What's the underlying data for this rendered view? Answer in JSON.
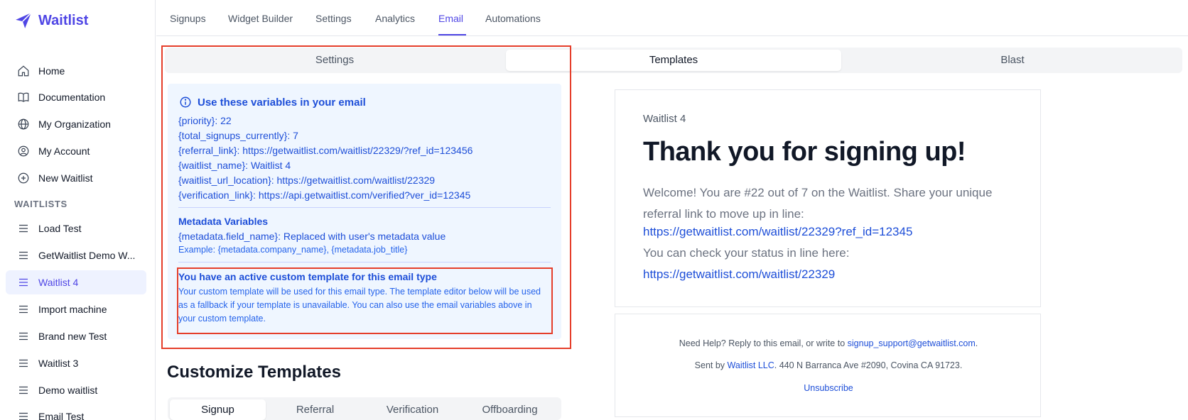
{
  "brand": {
    "name": "Waitlist"
  },
  "sidebar": {
    "items": [
      {
        "label": "Home"
      },
      {
        "label": "Documentation"
      },
      {
        "label": "My Organization"
      },
      {
        "label": "My Account"
      },
      {
        "label": "New Waitlist"
      }
    ],
    "section_label": "WAITLISTS",
    "waitlists": [
      {
        "label": "Load Test"
      },
      {
        "label": "GetWaitlist Demo W..."
      },
      {
        "label": "Waitlist 4"
      },
      {
        "label": "Import machine"
      },
      {
        "label": "Brand new Test"
      },
      {
        "label": "Waitlist 3"
      },
      {
        "label": "Demo waitlist"
      },
      {
        "label": "Email Test"
      }
    ],
    "active_waitlist": "Waitlist 4"
  },
  "topnav": {
    "tabs": [
      {
        "label": "Signups"
      },
      {
        "label": "Widget Builder"
      },
      {
        "label": "Settings"
      },
      {
        "label": "Analytics"
      },
      {
        "label": "Email"
      },
      {
        "label": "Automations"
      }
    ],
    "active": "Email"
  },
  "email_tabs": {
    "items": [
      {
        "label": "Settings"
      },
      {
        "label": "Templates"
      },
      {
        "label": "Blast"
      }
    ],
    "active": "Templates"
  },
  "variables": {
    "title": "Use these variables in your email",
    "lines": [
      "{priority}: 22",
      "{total_signups_currently}: 7",
      "{referral_link}: https://getwaitlist.com/waitlist/22329/?ref_id=123456",
      "{waitlist_name}: Waitlist 4",
      "{waitlist_url_location}: https://getwaitlist.com/waitlist/22329",
      "{verification_link}: https://api.getwaitlist.com/verified?ver_id=12345"
    ],
    "metadata_title": "Metadata Variables",
    "metadata_line": "{metadata.field_name}: Replaced with user's metadata value",
    "metadata_example": "Example: {metadata.company_name}, {metadata.job_title}",
    "custom_title": "You have an active custom template for this email type",
    "custom_desc": "Your custom template will be used for this email type. The template editor below will be used as a fallback if your template is unavailable. You can also use the email variables above in your custom template."
  },
  "customize": {
    "title": "Customize Templates",
    "tabs": [
      {
        "label": "Signup"
      },
      {
        "label": "Referral"
      },
      {
        "label": "Verification"
      },
      {
        "label": "Offboarding"
      }
    ],
    "active": "Signup"
  },
  "preview": {
    "waitlist_name": "Waitlist 4",
    "heading": "Thank you for signing up!",
    "body": "Welcome! You are #22 out of 7 on the Waitlist. Share your unique referral link to move up in line:",
    "referral_link": "https://getwaitlist.com/waitlist/22329?ref_id=12345",
    "status_text": "You can check your status in line here:",
    "status_link": "https://getwaitlist.com/waitlist/22329"
  },
  "footer": {
    "help_prefix": "Need Help? Reply to this email, or write to",
    "help_email": "signup_support@getwaitlist.com",
    "help_suffix": ".",
    "sent_prefix": "Sent by",
    "sent_company": "Waitlist LLC",
    "sent_address": ". 440 N Barranca Ave #2090, Covina CA 91723.",
    "unsubscribe": "Unsubscribe"
  },
  "colors": {
    "accent": "#4f46e5",
    "info_bg": "#eff6ff",
    "info_text": "#1d4ed8",
    "annotation": "#e53e2a"
  }
}
